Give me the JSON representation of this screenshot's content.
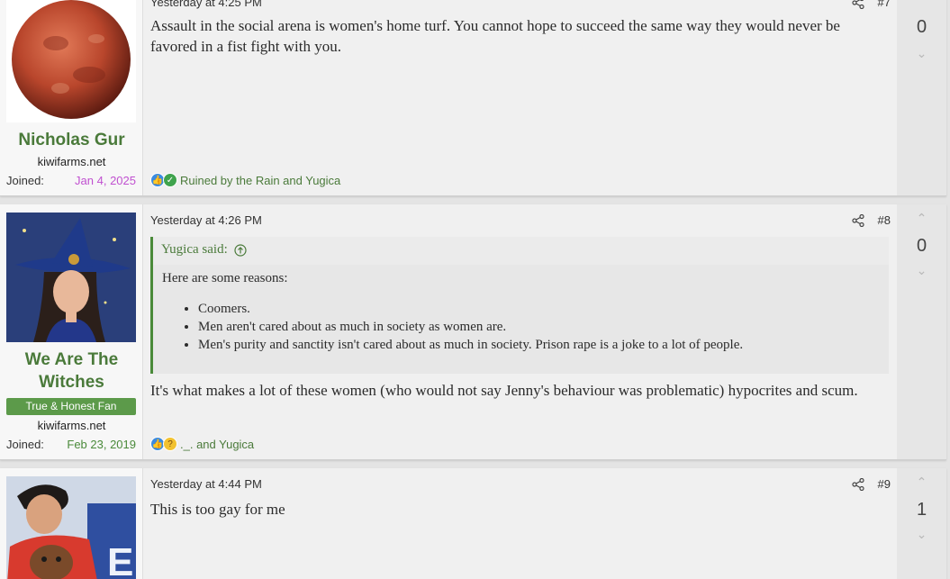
{
  "posts": [
    {
      "username": "Nicholas Gur",
      "user_title": "kiwifarms.net",
      "joined_label": "Joined:",
      "joined_date": "Jan 4, 2025",
      "joined_color": "#c050d0",
      "date": "Yesterday at 4:25 PM",
      "post_number": "#7",
      "body": "Assault in the social arena is women's home turf. You cannot hope to succeed the same way they would never be favored in a fist fight with you.",
      "reactions_text": "Ruined by the Rain and Yugica",
      "reaction_icons": [
        "like-icon",
        "check-icon"
      ],
      "score": "0"
    },
    {
      "username": "We Are The Witches",
      "banner": "True & Honest Fan",
      "user_title": "kiwifarms.net",
      "joined_label": "Joined:",
      "joined_date": "Feb 23, 2019",
      "joined_color": "#4a8a3a",
      "date": "Yesterday at 4:26 PM",
      "post_number": "#8",
      "quote": {
        "author": "Yugica said:",
        "intro": "Here are some reasons:",
        "items": [
          "Coomers.",
          "Men aren't cared about as much in society as women are.",
          "Men's purity and sanctity isn't cared about as much in society. Prison rape is a joke to a lot of people."
        ]
      },
      "body": "It's what makes a lot of these women (who would not say Jenny's behaviour was problematic) hypocrites and scum.",
      "reactions_text": "._. and Yugica",
      "reaction_icons": [
        "like-icon",
        "thinking-icon"
      ],
      "score": "0"
    },
    {
      "date": "Yesterday at 4:44 PM",
      "post_number": "#9",
      "body": "This is too gay for me",
      "score": "1"
    }
  ],
  "colors": {
    "accent": "#4a7a3a",
    "banner": "#5c9a4a",
    "like": "#3b8be0",
    "check": "#3fa34d"
  }
}
